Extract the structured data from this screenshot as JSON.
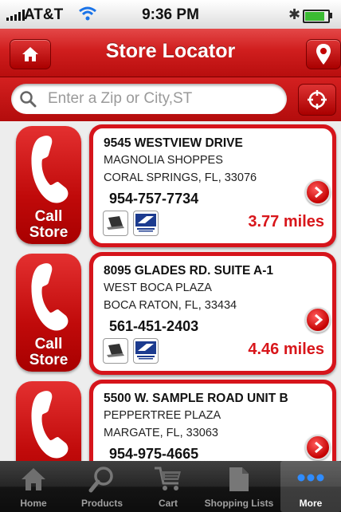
{
  "status_bar": {
    "carrier": "AT&T",
    "time": "9:36 PM",
    "icons": [
      "signal-icon",
      "wifi-icon",
      "bluetooth-icon",
      "battery-icon"
    ]
  },
  "nav": {
    "title": "Store Locator",
    "left_icon": "home-icon",
    "right_icon": "map-pin-icon"
  },
  "search": {
    "placeholder": "Enter a Zip or City,ST",
    "value": "",
    "locate_icon": "crosshair-icon"
  },
  "call_label": [
    "Call",
    "Store"
  ],
  "stores": [
    {
      "address1": "9545 WESTVIEW DRIVE",
      "address2": "MAGNOLIA SHOPPES",
      "address3": "CORAL SPRINGS, FL, 33076",
      "phone": "954-757-7734",
      "distance": "3.77 miles",
      "services": [
        "laptop-icon",
        "usps-icon"
      ]
    },
    {
      "address1": "8095 GLADES RD. SUITE A-1",
      "address2": "WEST BOCA PLAZA",
      "address3": "BOCA RATON, FL, 33434",
      "phone": "561-451-2403",
      "distance": "4.46 miles",
      "services": [
        "laptop-icon",
        "usps-icon"
      ]
    },
    {
      "address1": "5500 W. SAMPLE ROAD UNIT B",
      "address2": "PEPPERTREE PLAZA",
      "address3": "MARGATE, FL, 33063",
      "phone": "954-975-4665",
      "distance": "",
      "services": [
        "laptop-icon",
        "usps-icon"
      ]
    }
  ],
  "tabs": [
    {
      "label": "Home",
      "icon": "home-icon",
      "active": false
    },
    {
      "label": "Products",
      "icon": "magnifier-icon",
      "active": false
    },
    {
      "label": "Cart",
      "icon": "cart-icon",
      "active": false
    },
    {
      "label": "Shopping Lists",
      "icon": "list-icon",
      "active": false
    },
    {
      "label": "More",
      "icon": "more-dots-icon",
      "active": true
    }
  ],
  "colors": {
    "brand_red": "#d01e1e",
    "distance_red": "#d8161b",
    "tabbar": "#1a1a1a"
  }
}
